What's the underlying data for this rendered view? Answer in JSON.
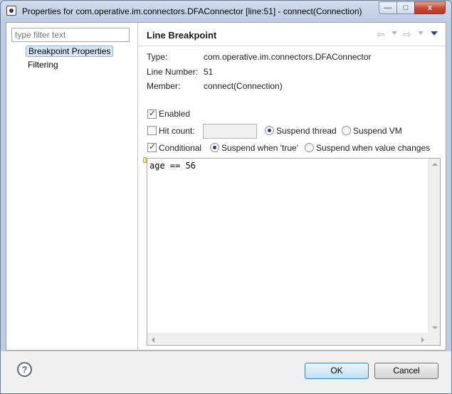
{
  "window": {
    "title": "Properties for com.operative.im.connectors.DFAConnector [line:51] - connect(Connection)",
    "min_glyph": "—",
    "max_glyph": "□",
    "close_glyph": "x"
  },
  "sidebar": {
    "filter_placeholder": "type filter text",
    "items": [
      {
        "label": "Breakpoint Properties",
        "selected": true
      },
      {
        "label": "Filtering",
        "selected": false
      }
    ]
  },
  "page": {
    "title": "Line Breakpoint",
    "nav": {
      "back_glyph": "⇦",
      "forward_glyph": "⇨"
    },
    "info": {
      "type_label": "Type:",
      "type_value": "com.operative.im.connectors.DFAConnector",
      "line_label": "Line Number:",
      "line_value": "51",
      "member_label": "Member:",
      "member_value": "connect(Connection)"
    },
    "enabled": {
      "label": "Enabled",
      "checked": true
    },
    "hit_count": {
      "label": "Hit count:",
      "checked": false,
      "value": ""
    },
    "suspend_thread": {
      "label": "Suspend thread",
      "selected": true
    },
    "suspend_vm": {
      "label": "Suspend VM",
      "selected": false
    },
    "conditional": {
      "label": "Conditional",
      "checked": true
    },
    "suspend_true": {
      "label": "Suspend when 'true'",
      "selected": true
    },
    "suspend_changes": {
      "label": "Suspend when value changes",
      "selected": false
    },
    "condition_text": "age == 56"
  },
  "footer": {
    "help_glyph": "?",
    "ok_label": "OK",
    "cancel_label": "Cancel"
  }
}
